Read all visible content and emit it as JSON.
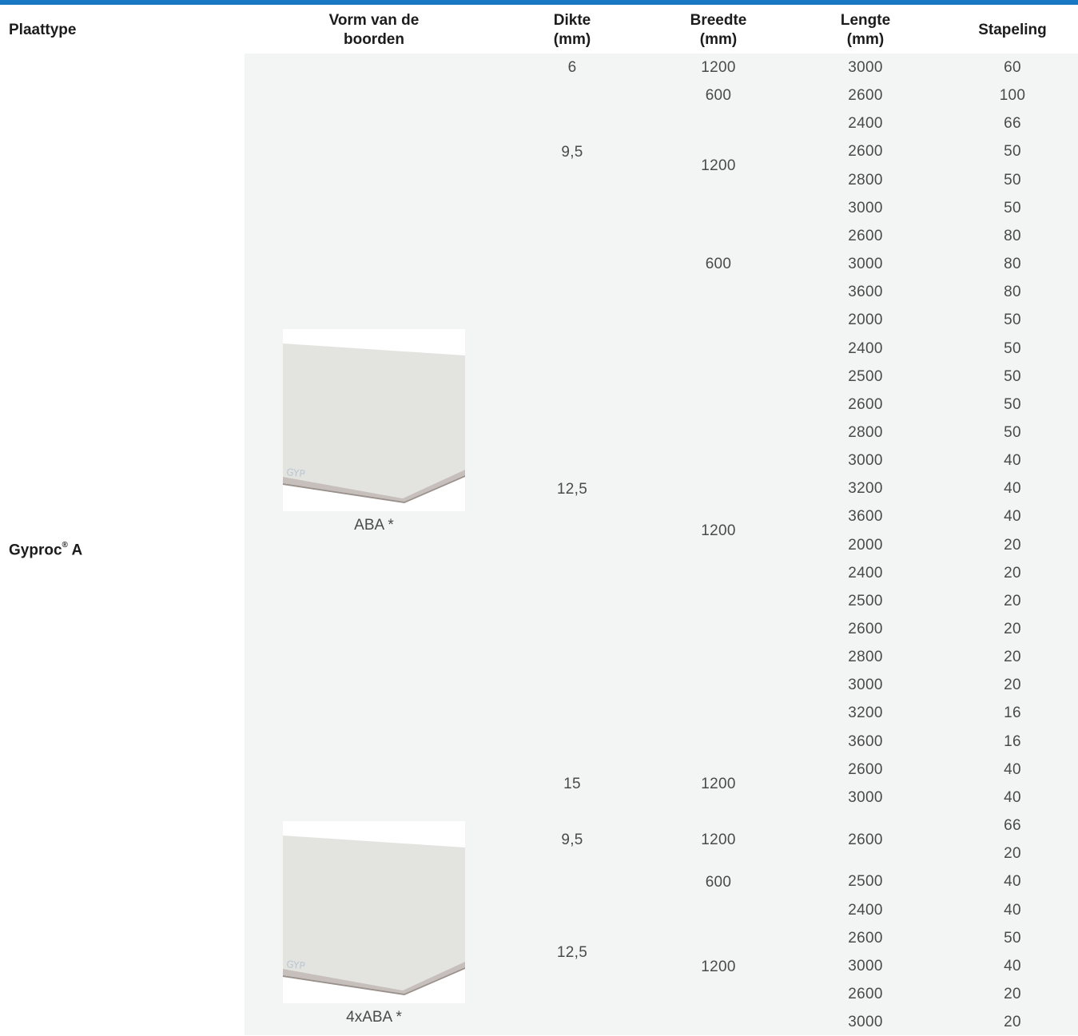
{
  "header": {
    "plaattype": "Plaattype",
    "vorm": "Vorm van de boorden",
    "vorm_l1": "Vorm van de",
    "vorm_l2": "boorden",
    "dikte_l1": "Dikte",
    "dikte_l2": "(mm)",
    "breedte_l1": "Breedte",
    "breedte_l2": "(mm)",
    "lengte_l1": "Lengte",
    "lengte_l2": "(mm)",
    "stapeling": "Stapeling"
  },
  "product": {
    "name": "Gyproc",
    "sup": "®",
    "suffix": " A"
  },
  "edge_types": [
    {
      "label": "ABA *",
      "image": "gypsum-board-image"
    },
    {
      "label": "4xABA *",
      "image": "gypsum-board-image"
    }
  ],
  "dikte": [
    "6",
    "9,5",
    "12,5",
    "15",
    "9,5",
    "12,5"
  ],
  "breedte": [
    "1200",
    "600",
    "1200",
    "600",
    "1200",
    "1200",
    "1200",
    "600",
    "1200"
  ],
  "lengte": [
    "3000",
    "2600",
    "2400",
    "2600",
    "2800",
    "3000",
    "2600",
    "3000",
    "3600",
    "2000",
    "2400",
    "2500",
    "2600",
    "2800",
    "3000",
    "3200",
    "3600",
    "2000",
    "2400",
    "2500",
    "2600",
    "2800",
    "3000",
    "3200",
    "3600",
    "2600",
    "3000",
    "2600",
    "2500",
    "2400",
    "2600",
    "3000",
    "2600",
    "3000"
  ],
  "stapeling": [
    "60",
    "100",
    "66",
    "50",
    "50",
    "50",
    "80",
    "80",
    "80",
    "50",
    "50",
    "50",
    "50",
    "50",
    "40",
    "40",
    "40",
    "20",
    "20",
    "20",
    "20",
    "20",
    "20",
    "16",
    "16",
    "40",
    "40",
    "66",
    "20",
    "40",
    "40",
    "50",
    "40",
    "20",
    "20"
  ],
  "colors": {
    "accent": "#1a78c2",
    "table_bg": "#f3f4f4"
  }
}
